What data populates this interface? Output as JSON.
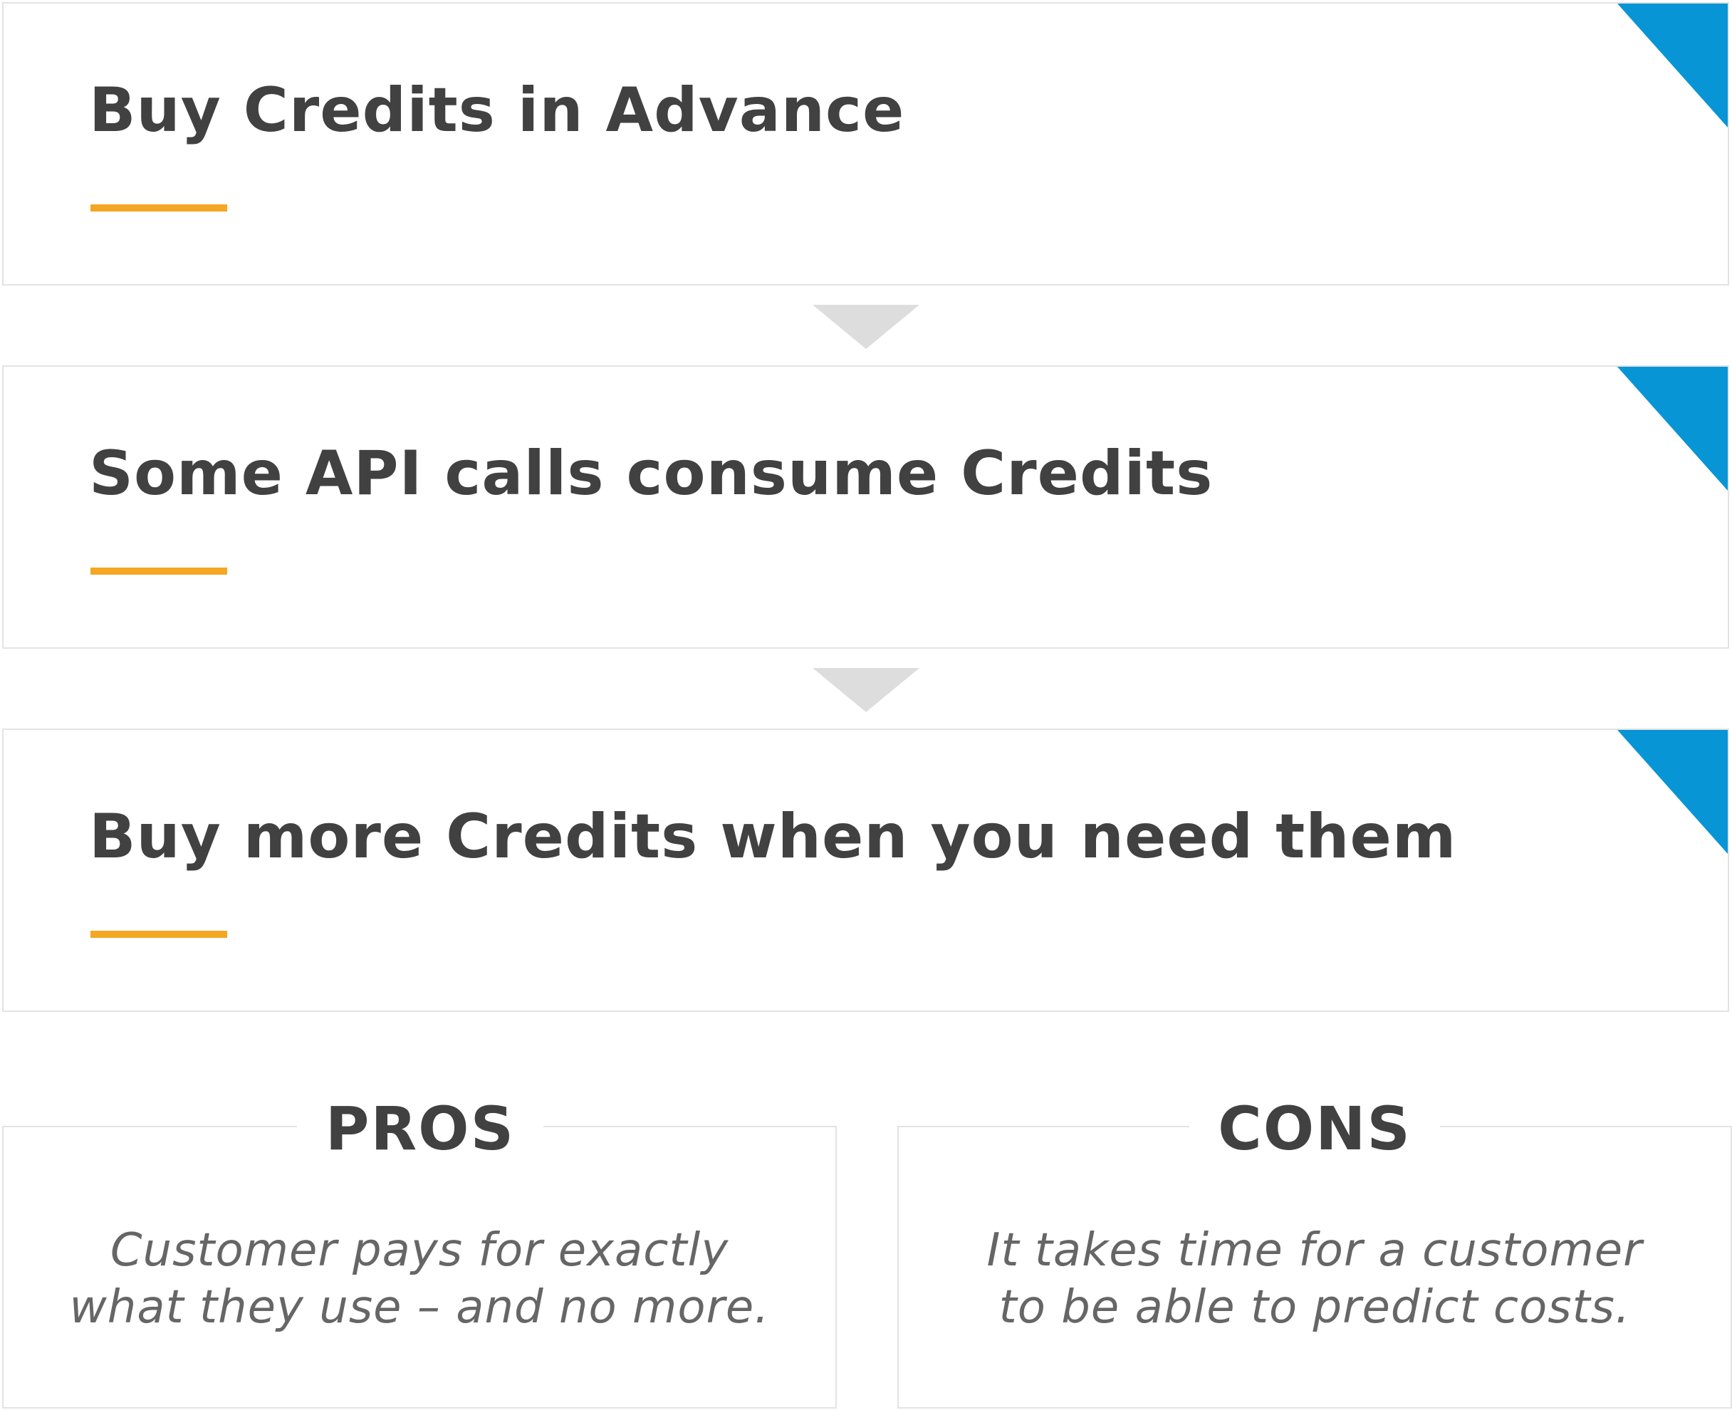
{
  "steps": [
    {
      "title": "Buy Credits in Advance"
    },
    {
      "title": "Some API calls consume Credits"
    },
    {
      "title": "Buy more Credits when you need them"
    }
  ],
  "pros": {
    "heading": "PROS",
    "lines": [
      "Customer pays for exactly",
      "what they use – and no more."
    ]
  },
  "cons": {
    "heading": "CONS",
    "lines": [
      "It takes time for a customer",
      "to be able to predict costs."
    ]
  },
  "colors": {
    "accent_blue": "#0895d6",
    "underline_orange": "#f5a623",
    "arrow_gray": "#dddddd",
    "text_dark": "#414141",
    "text_muted": "#666666"
  }
}
